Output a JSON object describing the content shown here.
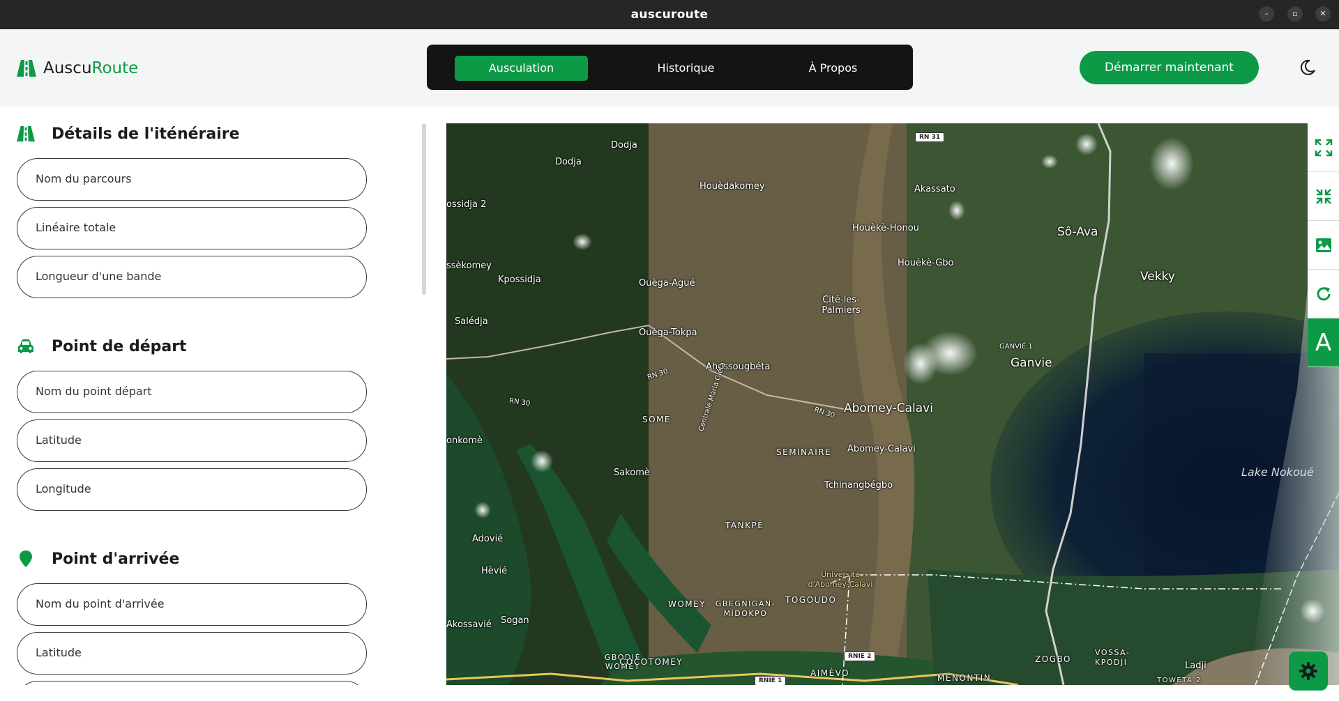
{
  "window": {
    "title": "auscuroute"
  },
  "header": {
    "logo_prefix": "Auscu",
    "logo_accent": "Route",
    "tabs": [
      {
        "label": "Ausculation",
        "active": true
      },
      {
        "label": "Historique",
        "active": false
      },
      {
        "label": "À Propos",
        "active": false
      }
    ],
    "start_button": "Démarrer maintenant",
    "theme_icon": "moon-icon"
  },
  "sections": [
    {
      "title": "Détails de l'iténéraire",
      "icon": "road-icon",
      "fields": [
        "Nom du parcours",
        "Linéaire totale",
        "Longueur d'une bande"
      ]
    },
    {
      "title": "Point de départ",
      "icon": "car-icon",
      "fields": [
        "Nom du point départ",
        "Latitude",
        "Longitude"
      ]
    },
    {
      "title": "Point d'arrivée",
      "icon": "location-pin-icon",
      "fields": [
        "Nom du point d'arrivée",
        "Latitude"
      ]
    }
  ],
  "map": {
    "labels": {
      "dodja_1": "Dodja",
      "dodja_2": "Dodja",
      "houedakomey": "Houèdakomey",
      "akassato": "Akassato",
      "kossidja2": "ossidja 2",
      "houeke_honou": "Houèkè-Honou",
      "so_ava": "Sô-Ava",
      "houeke_gbo": "Houèkè-Gbo",
      "kossidja": "Kpossidja",
      "ssekomey": "ssèkomey",
      "ouega_ague": "Ouèga-Agué",
      "vekky": "Vekky",
      "cite_palmiers": "Cité-les-Palmiers",
      "saledja": "Salédja",
      "ouega_tokpa": "Ouèga-Tokpa",
      "ganvie1": "GANVIÉ 1",
      "ganvie": "Ganvie",
      "ahossougbeta": "Ahossougbéta",
      "some": "SOMÈ",
      "abomey_calavi_big": "Abomey-Calavi",
      "konkome": "onkomè",
      "seminaire": "SEMINAIRE",
      "abomey_calavi": "Abomey-Calavi",
      "centrale": "Centrale Maria Gléta",
      "sakome": "Sakomè",
      "tchinangbegbo": "Tchinangbégbo",
      "lake": "Lake Nokoué",
      "tankpe": "TANKPÈ",
      "adovie": "Adovié",
      "universite": "Université d'Abomey-Calavi",
      "hevie": "Hèvié",
      "togoudo": "TOGOUDO",
      "womey": "WOMEY",
      "gbegnigan": "GBEGNIGAN-MIDOKPO",
      "akossavie": "Akossavié",
      "sogan": "Sogan",
      "gbodje": "GBODJÈ WOMEY",
      "cocotomey": "COCOTOMEY",
      "zogbo": "ZOGBO",
      "vossa": "VOSSA-KPODJI",
      "ladji": "Ladji",
      "aimevo": "AIMÈVO",
      "menontin": "MENONTIN",
      "toweta": "TOWETA 2"
    },
    "roads": {
      "rn31": "RN 31",
      "rn30_a": "RN 30",
      "rn30_b": "RN 30",
      "rn30_c": "RN 30",
      "rnie2": "RNIE 2",
      "rnie1": "RNIE 1"
    },
    "controls": [
      "expand-icon",
      "compress-icon",
      "image-icon",
      "refresh-icon",
      "A"
    ],
    "settings_icon": "gear-icon"
  }
}
